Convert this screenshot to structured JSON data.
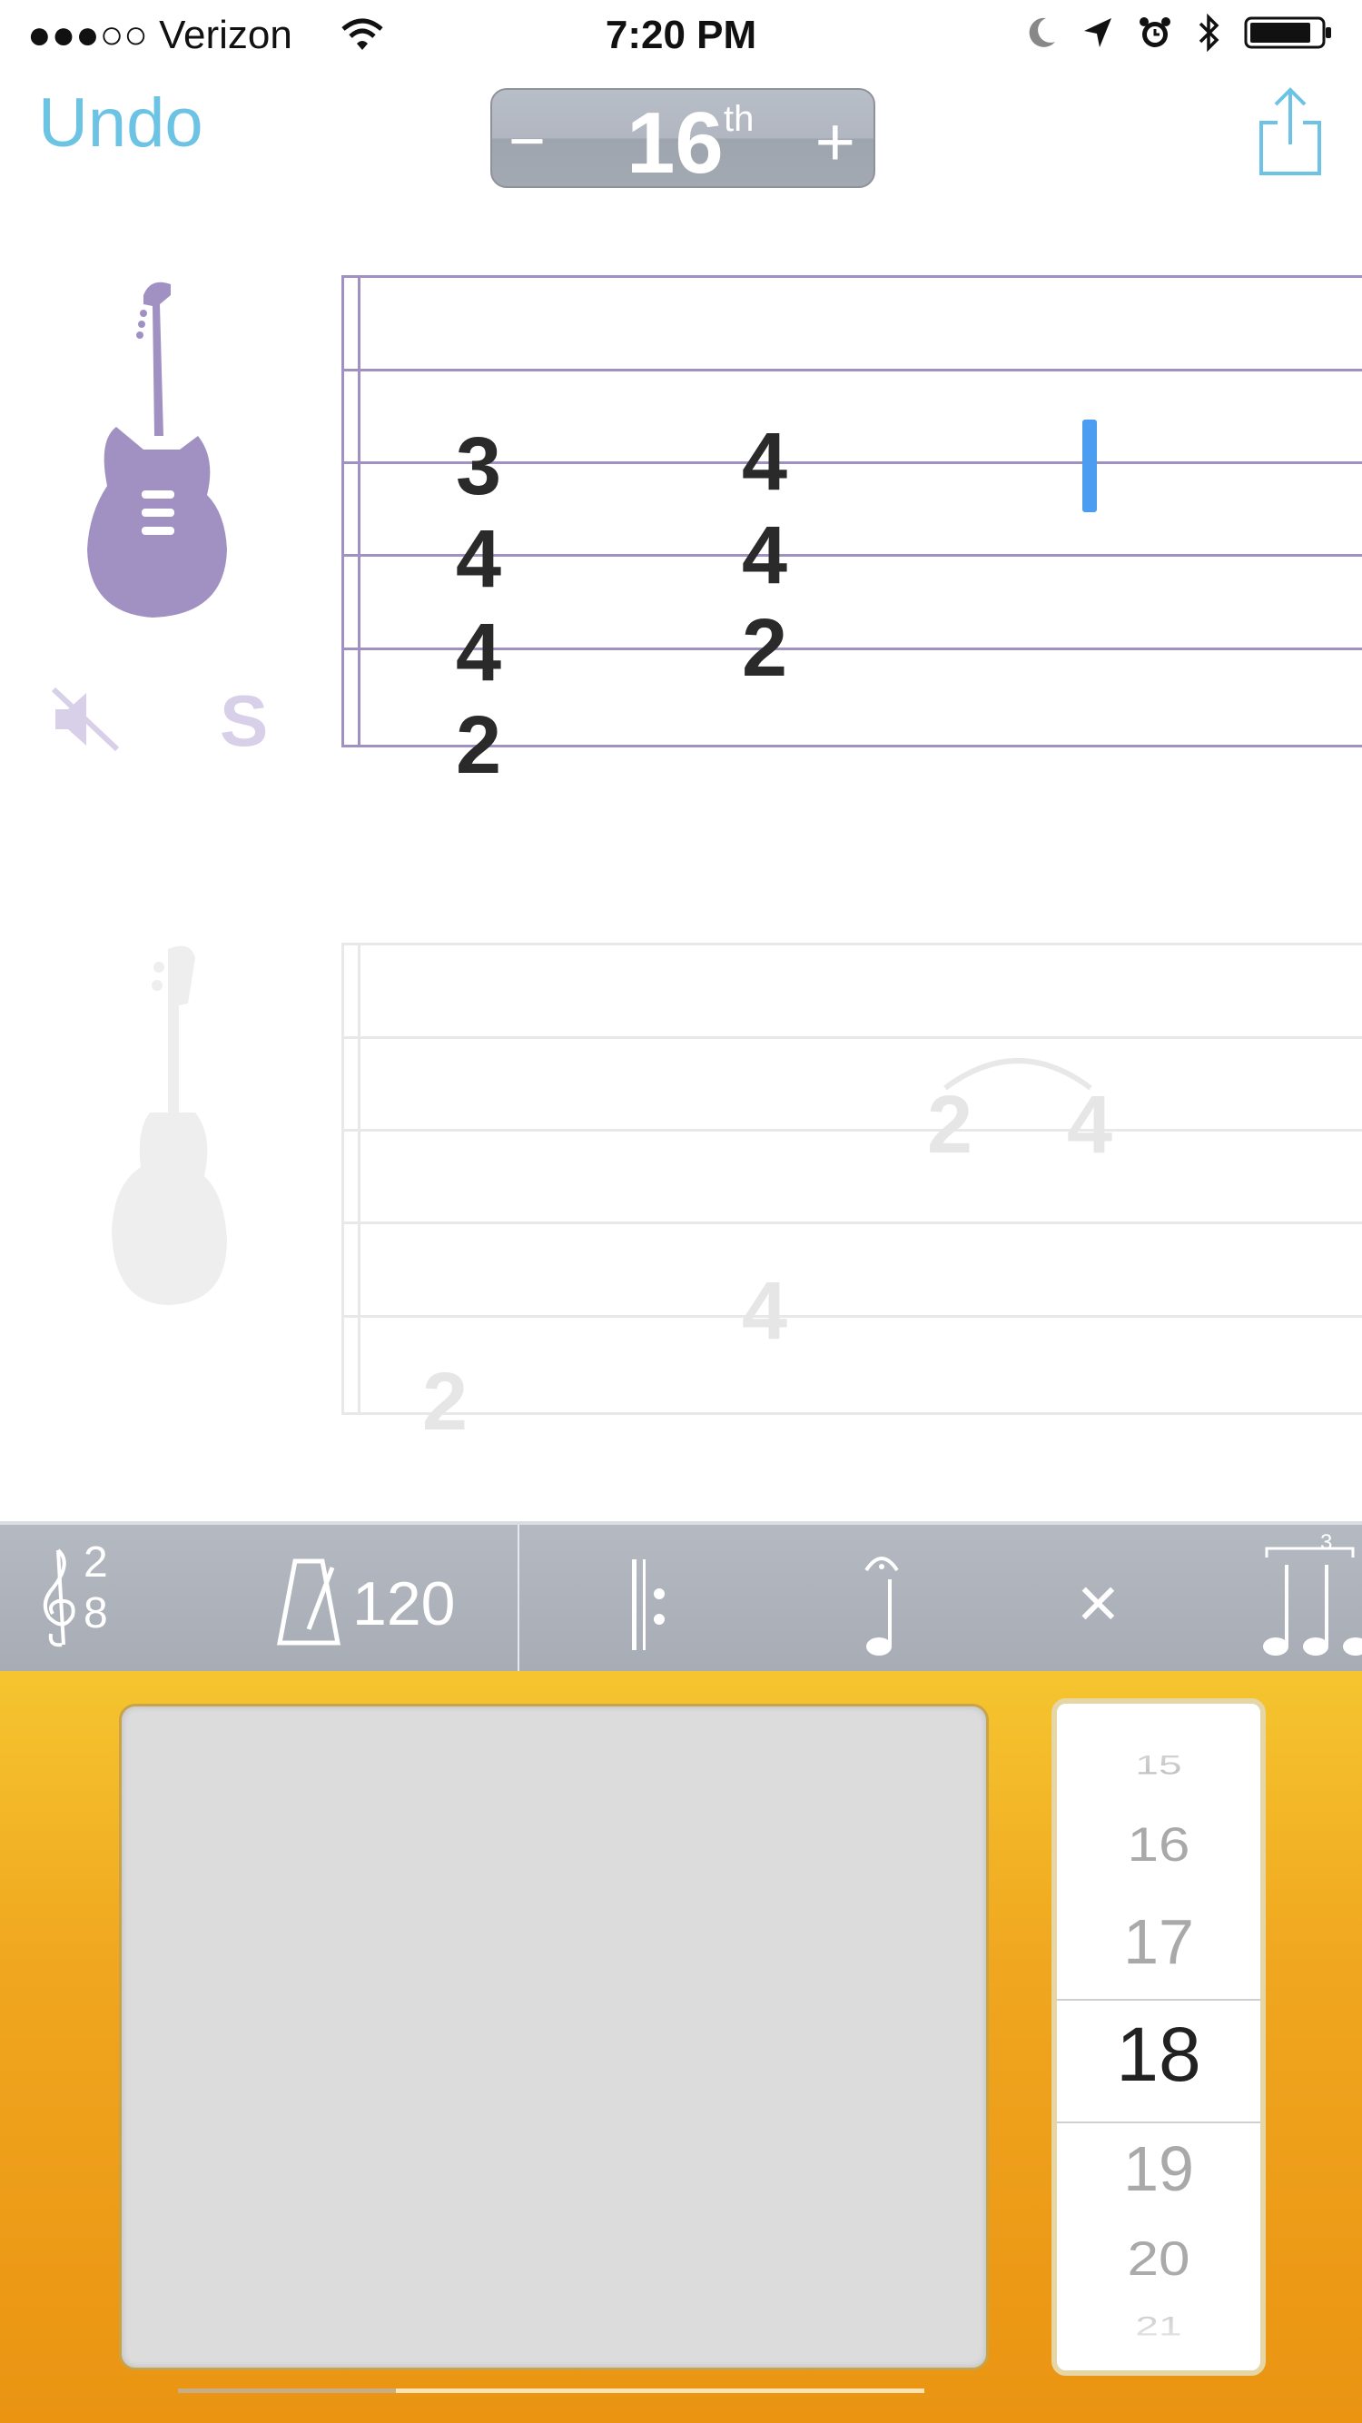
{
  "status_bar": {
    "carrier": "●●●○○ Verizon",
    "time": "7:20 PM",
    "icons": [
      "wifi-icon",
      "moon-icon",
      "location-arrow-icon",
      "alarm-icon",
      "bluetooth-icon",
      "battery-icon"
    ]
  },
  "nav": {
    "undo_label": "Undo",
    "note_value": {
      "minus": "−",
      "number": "16",
      "suffix": "th",
      "plus": "+"
    },
    "share_icon": "share-icon"
  },
  "tracks": [
    {
      "instrument_icon": "electric-guitar-icon",
      "color": "#a191c3",
      "mute_icon": "speaker-muted-icon",
      "solo_label": "S",
      "notes": [
        {
          "fret": "3",
          "string": 3
        },
        {
          "fret": "4",
          "string": 4
        },
        {
          "fret": "4",
          "string": 5
        },
        {
          "fret": "2",
          "string": 6
        },
        {
          "fret": "4",
          "string": 3
        },
        {
          "fret": "4",
          "string": 4
        },
        {
          "fret": "2",
          "string": 5
        }
      ]
    },
    {
      "instrument_icon": "bass-guitar-icon",
      "notes": [
        {
          "fret": "2",
          "string": 3
        },
        {
          "fret": "4",
          "string": 3
        },
        {
          "fret": "4",
          "string": 4
        },
        {
          "fret": "2",
          "string": 5
        }
      ]
    }
  ],
  "toolbar": {
    "time_signature": {
      "top": "2",
      "bottom": "8"
    },
    "tempo": "120",
    "items": [
      "treble-clef-icon",
      "metronome-icon",
      "repeat-start-icon",
      "fermata-icon",
      "close-icon",
      "triplet-icon"
    ],
    "triplet_label": "3"
  },
  "fret_picker": {
    "values": [
      "15",
      "16",
      "17",
      "18",
      "19",
      "20",
      "21"
    ],
    "selected": "18"
  },
  "colors": {
    "accent_blue": "#6cc3e3",
    "cursor_blue": "#4a9df0",
    "track_purple": "#a191c3",
    "panel_orange": "#f0a61f"
  }
}
